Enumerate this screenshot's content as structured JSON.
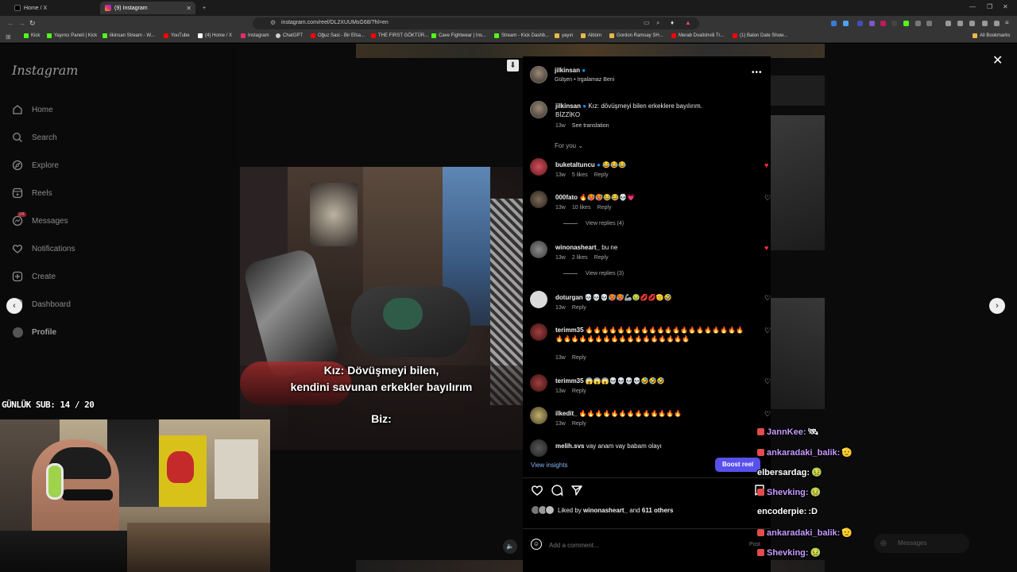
{
  "browser": {
    "tabs": [
      {
        "label": "Home / X",
        "active": false
      },
      {
        "label": "(9) Instagram",
        "active": true
      }
    ],
    "url": "instagram.com/reel/DL2XUUMsG68/?hl=en",
    "bookmarks": [
      {
        "label": "Kick",
        "color": "#53fc18"
      },
      {
        "label": "Yayıncı Paneli | Kick",
        "color": "#53fc18"
      },
      {
        "label": "ilkinsan Stream - W...",
        "color": "#53fc18"
      },
      {
        "label": "YouTube",
        "color": "#ff0000"
      },
      {
        "label": "(4) Home / X",
        "color": "#ffffff"
      },
      {
        "label": "Instagram",
        "color": "#e1306c"
      },
      {
        "label": "ChatGPT",
        "color": "#cccccc"
      },
      {
        "label": "Oğuz Sasi - Bir Efsa...",
        "color": "#ff0000"
      },
      {
        "label": "THE FIRST GÖKTÜR...",
        "color": "#ff0000"
      },
      {
        "label": "Cave Fightwear | Ins...",
        "color": "#53fc18"
      },
      {
        "label": "Stream - Kick Dashb...",
        "color": "#53fc18"
      },
      {
        "label": "yayın",
        "color": "#e8b84a"
      },
      {
        "label": "Albüm",
        "color": "#e8b84a"
      },
      {
        "label": "Gordon Ramsay SH...",
        "color": "#e8b84a"
      },
      {
        "label": "Merab Dvalishvili Tr...",
        "color": "#ff0000"
      },
      {
        "label": "(1) Balon Date Show...",
        "color": "#ff0000"
      }
    ],
    "all_bookmarks": "All Bookmarks"
  },
  "sidebar": {
    "logo": "Instagram",
    "items": [
      {
        "label": "Home",
        "icon": "home-icon"
      },
      {
        "label": "Search",
        "icon": "search-icon"
      },
      {
        "label": "Explore",
        "icon": "compass-icon"
      },
      {
        "label": "Reels",
        "icon": "reels-icon"
      },
      {
        "label": "Messages",
        "icon": "messenger-icon",
        "badge": "24"
      },
      {
        "label": "Notifications",
        "icon": "heart-icon"
      },
      {
        "label": "Create",
        "icon": "plus-square-icon"
      },
      {
        "label": "Dashboard",
        "icon": "dashboard-icon"
      },
      {
        "label": "Profile",
        "icon": "avatar-icon"
      }
    ]
  },
  "video": {
    "subtitle_line1": "Kız: Dövüşmeyi bilen,",
    "subtitle_line2": "kendini savunan erkekler bayılırım",
    "subtitle_line3": "Biz:"
  },
  "post": {
    "author": "jilkinsan",
    "audio": "Gülşen • Irgalamaz Beni",
    "caption_user": "jilkinsan",
    "caption_text": "Kız: dövüşmeyi bilen erkeklere bayılırım.",
    "caption_line2": "BİZZİKO",
    "caption_time": "13w",
    "see_translation": "See translation",
    "for_you": "For you",
    "view_insights": "View insights",
    "boost_reel": "Boost reel",
    "liked_by_prefix": "Liked by",
    "liked_by_user": "winonasheart_",
    "liked_by_and": "and",
    "liked_by_others": "611 others",
    "add_comment_placeholder": "Add a comment...",
    "post_label": "Post"
  },
  "comments": [
    {
      "user": "buketaltuncu",
      "text": "😂😂😂",
      "time": "13w",
      "likes": "5 likes",
      "reply": "Reply",
      "liked": true,
      "verified": true
    },
    {
      "user": "000fato",
      "text": "🔥🥵🥵😂😂💀💗",
      "time": "13w",
      "likes": "10 likes",
      "reply": "Reply",
      "liked": false,
      "view_replies": "View replies (4)"
    },
    {
      "user": "winonasheart_",
      "text": "bu ne",
      "time": "13w",
      "likes": "2 likes",
      "reply": "Reply",
      "liked": true,
      "view_replies": "View replies (3)"
    },
    {
      "user": "doturgan",
      "text": "💀💀💀🥵🥵🦾🤢💋💋🫡🤣",
      "time": "13w",
      "likes": "",
      "reply": "Reply",
      "liked": false
    },
    {
      "user": "terimm35",
      "text": "🔥🔥🔥🔥🔥🔥🔥🔥🔥🔥🔥🔥🔥🔥🔥🔥🔥🔥🔥🔥🔥🔥🔥🔥🔥🔥🔥🔥🔥🔥🔥🔥🔥🔥🔥🔥🔥",
      "time": "13w",
      "likes": "",
      "reply": "Reply",
      "liked": false
    },
    {
      "user": "terimm35",
      "text": "😱😱😱💀💀💀💀🤣🤣🤣",
      "time": "13w",
      "likes": "",
      "reply": "Reply",
      "liked": false
    },
    {
      "user": "ilkedit_",
      "text": "🔥🔥🔥🔥🔥🔥🔥🔥🔥🔥🔥🔥🔥",
      "time": "13w",
      "likes": "",
      "reply": "Reply",
      "liked": false
    },
    {
      "user": "melih.svs",
      "text": "vay anam vay babam olayı",
      "time": "",
      "likes": "",
      "reply": "",
      "liked": false
    }
  ],
  "stream": {
    "sub_goal": "GÜNLÜK SUB: 14 / 20",
    "chat": [
      {
        "user": "JannKee:",
        "msg": "🛰",
        "badge": true
      },
      {
        "user": "ankaradaki_balik:",
        "msg": "🫡",
        "badge": true
      },
      {
        "user": "elbersardag:",
        "msg": "🤢",
        "badge": false,
        "white": true
      },
      {
        "user": "Shevking:",
        "msg": "🤢",
        "badge": true
      },
      {
        "user": "encoderpie:",
        "msg": ":D",
        "badge": false,
        "white": true
      },
      {
        "user": "ankaradaki_balik:",
        "msg": "🫡",
        "badge": true
      },
      {
        "user": "Shevking:",
        "msg": "🤢",
        "badge": true
      }
    ],
    "messages_label": "Messages"
  },
  "colors": {
    "accent_blue": "#0095f6",
    "boost_button": "#5850ec",
    "like_red": "#ff3040"
  }
}
